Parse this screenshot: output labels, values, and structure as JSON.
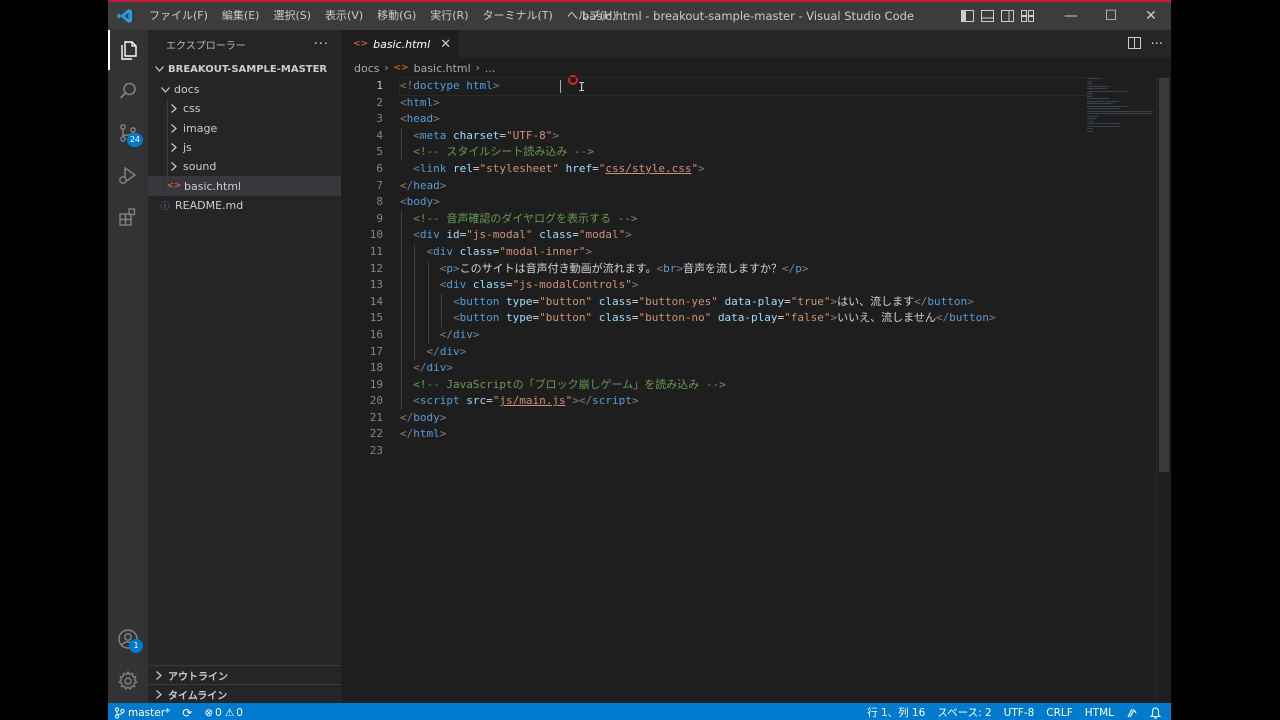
{
  "window": {
    "title": "basic.html - breakout-sample-master - Visual Studio Code",
    "menu": [
      "ファイル(F)",
      "編集(E)",
      "選択(S)",
      "表示(V)",
      "移動(G)",
      "実行(R)",
      "ターミナル(T)",
      "ヘルプ(H)"
    ],
    "controls": {
      "minimize": "—",
      "maximize": "☐",
      "close": "✕"
    }
  },
  "activity_bar": {
    "items": [
      {
        "name": "explorer",
        "icon": "files-icon",
        "active": true
      },
      {
        "name": "search",
        "icon": "search-icon"
      },
      {
        "name": "source-control",
        "icon": "source-control-icon",
        "badge": "24"
      },
      {
        "name": "run-debug",
        "icon": "run-debug-icon"
      },
      {
        "name": "extensions",
        "icon": "extensions-icon"
      }
    ],
    "bottom": [
      {
        "name": "accounts",
        "icon": "account-icon",
        "badge": "1"
      },
      {
        "name": "manage",
        "icon": "gear-icon"
      }
    ]
  },
  "sidebar": {
    "header": "エクスプローラー",
    "more": "···",
    "section": "BREAKOUT-SAMPLE-MASTER",
    "tree": [
      {
        "label": "docs",
        "type": "folder",
        "open": true,
        "depth": 0
      },
      {
        "label": "css",
        "type": "folder",
        "open": false,
        "depth": 1
      },
      {
        "label": "image",
        "type": "folder",
        "open": false,
        "depth": 1
      },
      {
        "label": "js",
        "type": "folder",
        "open": false,
        "depth": 1
      },
      {
        "label": "sound",
        "type": "folder",
        "open": false,
        "depth": 1
      },
      {
        "label": "basic.html",
        "type": "html",
        "depth": 1,
        "selected": true
      },
      {
        "label": "README.md",
        "type": "info",
        "depth": 0
      }
    ],
    "bottom_panes": [
      "アウトライン",
      "タイムライン"
    ]
  },
  "editor": {
    "tab": {
      "label": "basic.html",
      "close": "✕"
    },
    "breadcrumb": [
      "docs",
      "basic.html",
      "..."
    ],
    "current_line": 1,
    "lines": [
      [
        [
          "br",
          "<!"
        ],
        [
          "tag",
          "doctype html"
        ],
        [
          "br",
          ">"
        ]
      ],
      [
        [
          "br",
          "<"
        ],
        [
          "tag",
          "html"
        ],
        [
          "br",
          ">"
        ]
      ],
      [
        [
          "br",
          "<"
        ],
        [
          "tag",
          "head"
        ],
        [
          "br",
          ">"
        ]
      ],
      [
        [
          "tx",
          "  "
        ],
        [
          "br",
          "<"
        ],
        [
          "tag",
          "meta "
        ],
        [
          "at",
          "charset"
        ],
        [
          "tx",
          "="
        ],
        [
          "st",
          "\"UTF-8\""
        ],
        [
          "br",
          ">"
        ]
      ],
      [
        [
          "tx",
          "  "
        ],
        [
          "cm",
          "<!-- スタイルシート読み込み -->"
        ]
      ],
      [
        [
          "tx",
          "  "
        ],
        [
          "br",
          "<"
        ],
        [
          "tag",
          "link "
        ],
        [
          "at",
          "rel"
        ],
        [
          "tx",
          "="
        ],
        [
          "st",
          "\"stylesheet\""
        ],
        [
          "tx",
          " "
        ],
        [
          "at",
          "href"
        ],
        [
          "tx",
          "="
        ],
        [
          "st",
          "\""
        ],
        [
          "stu",
          "css/style.css"
        ],
        [
          "st",
          "\""
        ],
        [
          "br",
          ">"
        ]
      ],
      [
        [
          "br",
          "</"
        ],
        [
          "tag",
          "head"
        ],
        [
          "br",
          ">"
        ]
      ],
      [
        [
          "br",
          "<"
        ],
        [
          "tag",
          "body"
        ],
        [
          "br",
          ">"
        ]
      ],
      [
        [
          "tx",
          "  "
        ],
        [
          "cm",
          "<!-- 音声確認のダイヤログを表示する -->"
        ]
      ],
      [
        [
          "tx",
          "  "
        ],
        [
          "br",
          "<"
        ],
        [
          "tag",
          "div "
        ],
        [
          "at",
          "id"
        ],
        [
          "tx",
          "="
        ],
        [
          "st",
          "\"js-modal\""
        ],
        [
          "tx",
          " "
        ],
        [
          "at",
          "class"
        ],
        [
          "tx",
          "="
        ],
        [
          "st",
          "\"modal\""
        ],
        [
          "br",
          ">"
        ]
      ],
      [
        [
          "tx",
          "    "
        ],
        [
          "br",
          "<"
        ],
        [
          "tag",
          "div "
        ],
        [
          "at",
          "class"
        ],
        [
          "tx",
          "="
        ],
        [
          "st",
          "\"modal-inner\""
        ],
        [
          "br",
          ">"
        ]
      ],
      [
        [
          "tx",
          "      "
        ],
        [
          "br",
          "<"
        ],
        [
          "tag",
          "p"
        ],
        [
          "br",
          ">"
        ],
        [
          "tx",
          "このサイトは音声付き動画が流れます。"
        ],
        [
          "br",
          "<"
        ],
        [
          "tag",
          "br"
        ],
        [
          "br",
          ">"
        ],
        [
          "tx",
          "音声を流しますか？"
        ],
        [
          "br",
          "</"
        ],
        [
          "tag",
          "p"
        ],
        [
          "br",
          ">"
        ]
      ],
      [
        [
          "tx",
          "      "
        ],
        [
          "br",
          "<"
        ],
        [
          "tag",
          "div "
        ],
        [
          "at",
          "class"
        ],
        [
          "tx",
          "="
        ],
        [
          "st",
          "\"js-modalControls\""
        ],
        [
          "br",
          ">"
        ]
      ],
      [
        [
          "tx",
          "        "
        ],
        [
          "br",
          "<"
        ],
        [
          "tag",
          "button "
        ],
        [
          "at",
          "type"
        ],
        [
          "tx",
          "="
        ],
        [
          "st",
          "\"button\""
        ],
        [
          "tx",
          " "
        ],
        [
          "at",
          "class"
        ],
        [
          "tx",
          "="
        ],
        [
          "st",
          "\"button-yes\""
        ],
        [
          "tx",
          " "
        ],
        [
          "at",
          "data-play"
        ],
        [
          "tx",
          "="
        ],
        [
          "st",
          "\"true\""
        ],
        [
          "br",
          ">"
        ],
        [
          "tx",
          "はい、流します"
        ],
        [
          "br",
          "</"
        ],
        [
          "tag",
          "button"
        ],
        [
          "br",
          ">"
        ]
      ],
      [
        [
          "tx",
          "        "
        ],
        [
          "br",
          "<"
        ],
        [
          "tag",
          "button "
        ],
        [
          "at",
          "type"
        ],
        [
          "tx",
          "="
        ],
        [
          "st",
          "\"button\""
        ],
        [
          "tx",
          " "
        ],
        [
          "at",
          "class"
        ],
        [
          "tx",
          "="
        ],
        [
          "st",
          "\"button-no\""
        ],
        [
          "tx",
          " "
        ],
        [
          "at",
          "data-play"
        ],
        [
          "tx",
          "="
        ],
        [
          "st",
          "\"false\""
        ],
        [
          "br",
          ">"
        ],
        [
          "tx",
          "いいえ、流しません"
        ],
        [
          "br",
          "</"
        ],
        [
          "tag",
          "button"
        ],
        [
          "br",
          ">"
        ]
      ],
      [
        [
          "tx",
          "      "
        ],
        [
          "br",
          "</"
        ],
        [
          "tag",
          "div"
        ],
        [
          "br",
          ">"
        ]
      ],
      [
        [
          "tx",
          "    "
        ],
        [
          "br",
          "</"
        ],
        [
          "tag",
          "div"
        ],
        [
          "br",
          ">"
        ]
      ],
      [
        [
          "tx",
          "  "
        ],
        [
          "br",
          "</"
        ],
        [
          "tag",
          "div"
        ],
        [
          "br",
          ">"
        ]
      ],
      [
        [
          "tx",
          "  "
        ],
        [
          "cm",
          "<!-- JavaScriptの「ブロック崩しゲーム」を読み込み -->"
        ]
      ],
      [
        [
          "tx",
          "  "
        ],
        [
          "br",
          "<"
        ],
        [
          "tag",
          "script "
        ],
        [
          "at",
          "src"
        ],
        [
          "tx",
          "="
        ],
        [
          "st",
          "\""
        ],
        [
          "stu",
          "js/main.js"
        ],
        [
          "st",
          "\""
        ],
        [
          "br",
          "></"
        ],
        [
          "tag",
          "script"
        ],
        [
          "br",
          ">"
        ]
      ],
      [
        [
          "br",
          "</"
        ],
        [
          "tag",
          "body"
        ],
        [
          "br",
          ">"
        ]
      ],
      [
        [
          "br",
          "</"
        ],
        [
          "tag",
          "html"
        ],
        [
          "br",
          ">"
        ]
      ],
      []
    ]
  },
  "statusbar": {
    "branch": "master*",
    "sync": "⟳",
    "errors": "0",
    "warnings": "0",
    "position": "行 1、列 16",
    "spaces": "スペース: 2",
    "encoding": "UTF-8",
    "eol": "CRLF",
    "language": "HTML"
  },
  "colors": {
    "accent": "#007acc",
    "editor_bg": "#1e1e1e",
    "sidebar_bg": "#252526",
    "activity_bg": "#333333",
    "titlebar_bg": "#3c3c3c"
  }
}
